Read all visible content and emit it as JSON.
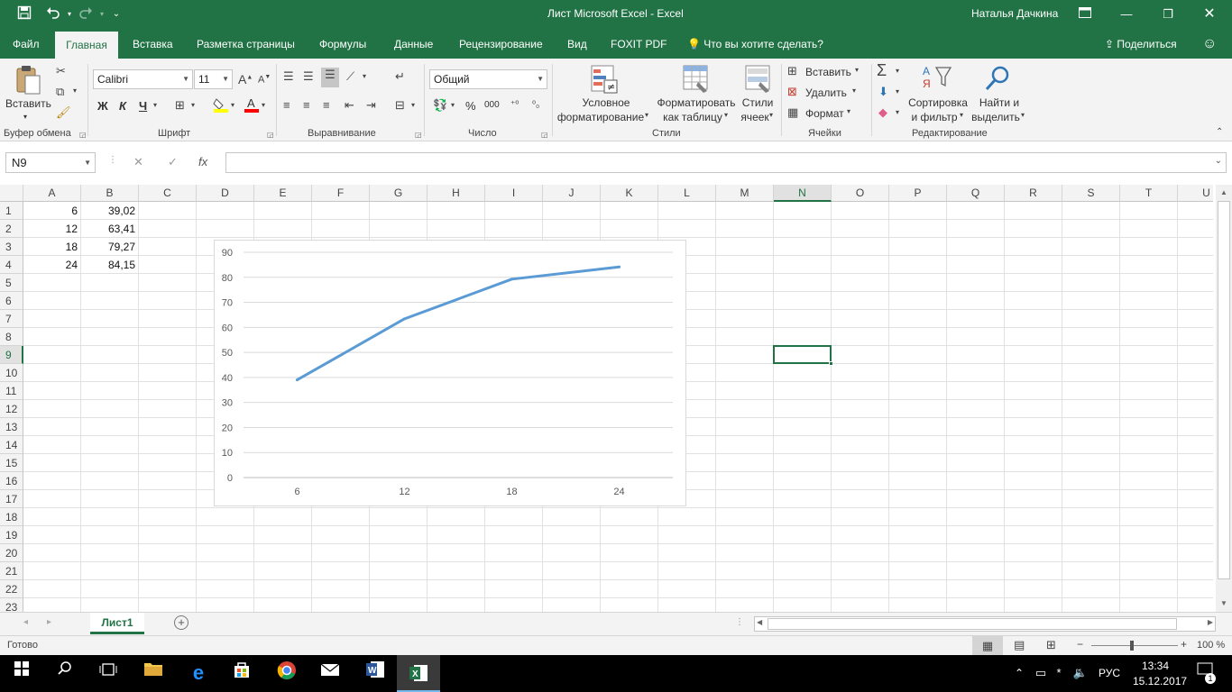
{
  "window": {
    "title": "Лист Microsoft Excel  -  Excel",
    "user": "Наталья Дачкина"
  },
  "tabs": [
    "Файл",
    "Главная",
    "Вставка",
    "Разметка страницы",
    "Формулы",
    "Данные",
    "Рецензирование",
    "Вид",
    "FOXIT PDF"
  ],
  "tell_me": "Что вы хотите сделать?",
  "share": "Поделиться",
  "ribbon": {
    "paste": "Вставить",
    "clipboard_group": "Буфер обмена",
    "font_name": "Calibri",
    "font_size": "11",
    "bold": "Ж",
    "italic": "К",
    "underline": "Ч",
    "font_group": "Шрифт",
    "align_group": "Выравнивание",
    "number_format": "Общий",
    "percent": "%",
    "thousands": "000",
    "number_group": "Число",
    "cond_format_1": "Условное",
    "cond_format_2": "форматирование",
    "format_table_1": "Форматировать",
    "format_table_2": "как таблицу",
    "cell_styles_1": "Стили",
    "cell_styles_2": "ячеек",
    "styles_group": "Стили",
    "insert_cells": "Вставить",
    "delete_cells": "Удалить",
    "format_cells": "Формат",
    "cells_group": "Ячейки",
    "sort_1": "Сортировка",
    "sort_2": "и фильтр",
    "find_1": "Найти и",
    "find_2": "выделить",
    "edit_group": "Редактирование"
  },
  "formula_bar": {
    "name_box": "N9",
    "fx": "fx",
    "value": ""
  },
  "columns": [
    "A",
    "B",
    "C",
    "D",
    "E",
    "F",
    "G",
    "H",
    "I",
    "J",
    "K",
    "L",
    "M",
    "N",
    "O",
    "P",
    "Q",
    "R",
    "S",
    "T",
    "U"
  ],
  "rows": [
    "1",
    "2",
    "3",
    "4",
    "5",
    "6",
    "7",
    "8",
    "9",
    "10",
    "11",
    "12",
    "13",
    "14",
    "15",
    "16",
    "17",
    "18",
    "19",
    "20",
    "21",
    "22",
    "23"
  ],
  "cells": {
    "A": [
      "6",
      "12",
      "18",
      "24"
    ],
    "B": [
      "39,02",
      "63,41",
      "79,27",
      "84,15"
    ]
  },
  "selected_cell": "N9",
  "chart_data": {
    "type": "line",
    "categories": [
      "6",
      "12",
      "18",
      "24"
    ],
    "series": [
      {
        "values": [
          39.02,
          63.41,
          79.27,
          84.15
        ],
        "color": "#5b9bd5"
      }
    ],
    "yticks": [
      "0",
      "10",
      "20",
      "30",
      "40",
      "50",
      "60",
      "70",
      "80",
      "90"
    ],
    "ylim": [
      0,
      90
    ],
    "grid": true,
    "legend": "none"
  },
  "sheet_tab": "Лист1",
  "status": {
    "ready": "Готово",
    "zoom": "100 %"
  },
  "taskbar": {
    "lang": "РУС",
    "time": "13:34",
    "date": "15.12.2017",
    "notif_count": "1"
  },
  "colors": {
    "excel_green": "#217346",
    "ribbon_bg": "#f3f3f3",
    "series": "#5b9bd5"
  }
}
